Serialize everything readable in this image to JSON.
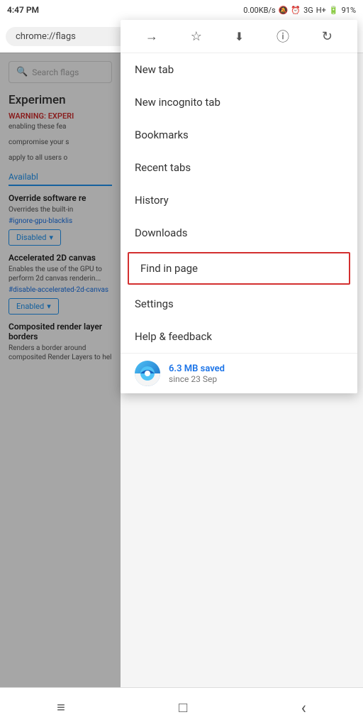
{
  "statusBar": {
    "time": "4:47 PM",
    "network": "0.00KB/s",
    "carrier": "3G",
    "carrier2": "H+",
    "battery": "91%"
  },
  "addressBar": {
    "url": "chrome://flags"
  },
  "searchBar": {
    "placeholder": "Search flags"
  },
  "pageContent": {
    "title": "Experimen",
    "warningLabel": "WARNING: EXPERI",
    "bodyText1": "enabling these fea",
    "bodyText2": "compromise your s",
    "bodyText3": "apply to all users o",
    "tabLabel": "Availabl",
    "section1Title": "Override software re",
    "section1Desc": "Overrides the built-in",
    "section1Link": "#ignore-gpu-blacklis",
    "section1Button": "Disabled",
    "section2Title": "Accelerated 2D canvas",
    "section2Desc": "Enables the use of the GPU to perform 2d canvas renderin...",
    "section2Link": "#disable-accelerated-2d-canvas",
    "section2Button": "Enabled",
    "section3Title": "Composited render layer borders",
    "section3Desc": "Renders a border around composited Render Layers to hel"
  },
  "menu": {
    "toolbar": {
      "forward": "→",
      "bookmark": "☆",
      "download": "↓",
      "info": "ⓘ",
      "refresh": "↻"
    },
    "items": [
      {
        "id": "new-tab",
        "label": "New tab"
      },
      {
        "id": "new-incognito-tab",
        "label": "New incognito tab"
      },
      {
        "id": "bookmarks",
        "label": "Bookmarks"
      },
      {
        "id": "recent-tabs",
        "label": "Recent tabs"
      },
      {
        "id": "history",
        "label": "History"
      },
      {
        "id": "downloads",
        "label": "Downloads"
      }
    ],
    "highlightedItem": {
      "id": "find-in-page",
      "label": "Find in page"
    },
    "bottomItems": [
      {
        "id": "settings",
        "label": "Settings"
      },
      {
        "id": "help-feedback",
        "label": "Help & feedback"
      }
    ],
    "footer": {
      "primaryText": "6.3 MB saved",
      "secondaryText": "since 23 Sep"
    }
  },
  "bottomNav": {
    "menu": "≡",
    "home": "□",
    "back": "‹"
  }
}
